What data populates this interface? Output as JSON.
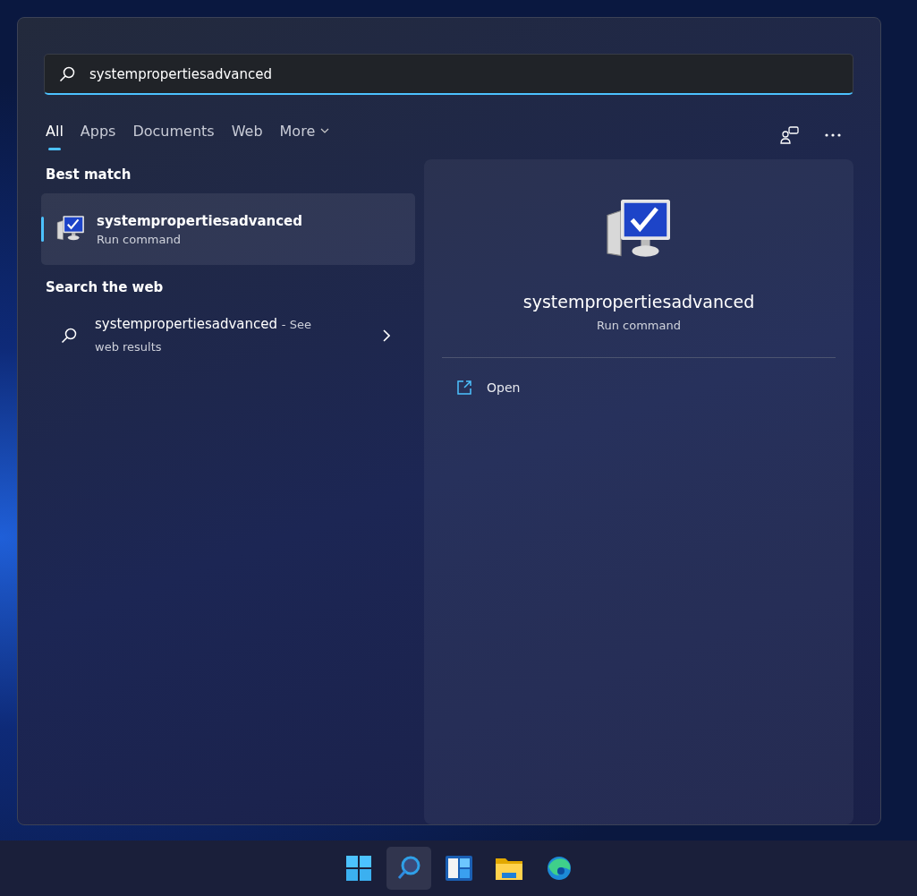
{
  "search": {
    "value": "systempropertiesadvanced"
  },
  "tabs": [
    {
      "label": "All",
      "selected": true,
      "menu": false
    },
    {
      "label": "Apps",
      "selected": false,
      "menu": false
    },
    {
      "label": "Documents",
      "selected": false,
      "menu": false
    },
    {
      "label": "Web",
      "selected": false,
      "menu": false
    },
    {
      "label": "More",
      "selected": false,
      "menu": true
    }
  ],
  "best_match": {
    "heading": "Best match",
    "title": "systempropertiesadvanced",
    "subtitle": "Run command",
    "selected": true
  },
  "web": {
    "heading": "Search the web",
    "query": "systempropertiesadvanced",
    "hint": "- See web results"
  },
  "detail": {
    "title": "systempropertiesadvanced",
    "subtitle": "Run command",
    "actions": [
      {
        "label": "Open"
      }
    ]
  },
  "taskbar": [
    {
      "kind": "start",
      "selected": false
    },
    {
      "kind": "search",
      "selected": true
    },
    {
      "kind": "widgets",
      "selected": false
    },
    {
      "kind": "folder",
      "selected": false
    },
    {
      "kind": "browser",
      "selected": false
    }
  ]
}
